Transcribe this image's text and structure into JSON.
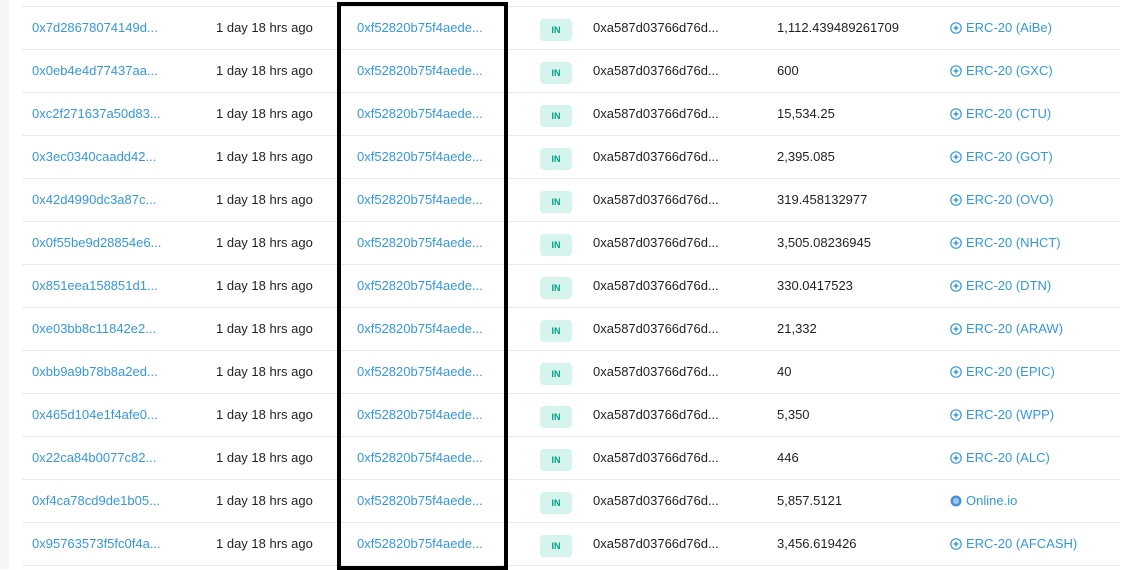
{
  "table": {
    "direction_badge": "IN",
    "rows": [
      {
        "hash": "0x7d28678074149d...",
        "age": "1 day 18 hrs ago",
        "from": "0xf52820b75f4aede...",
        "to": "0xa587d03766d76d...",
        "value": "1,112.439489261709",
        "token": "ERC-20 (AiBe)",
        "token_icon": "erc20-token-icon"
      },
      {
        "hash": "0x0eb4e4d77437aa...",
        "age": "1 day 18 hrs ago",
        "from": "0xf52820b75f4aede...",
        "to": "0xa587d03766d76d...",
        "value": "600",
        "token": "ERC-20 (GXC)",
        "token_icon": "erc20-token-icon"
      },
      {
        "hash": "0xc2f271637a50d83...",
        "age": "1 day 18 hrs ago",
        "from": "0xf52820b75f4aede...",
        "to": "0xa587d03766d76d...",
        "value": "15,534.25",
        "token": "ERC-20 (CTU)",
        "token_icon": "erc20-token-icon"
      },
      {
        "hash": "0x3ec0340caadd42...",
        "age": "1 day 18 hrs ago",
        "from": "0xf52820b75f4aede...",
        "to": "0xa587d03766d76d...",
        "value": "2,395.085",
        "token": "ERC-20 (GOT)",
        "token_icon": "erc20-token-icon"
      },
      {
        "hash": "0x42d4990dc3a87c...",
        "age": "1 day 18 hrs ago",
        "from": "0xf52820b75f4aede...",
        "to": "0xa587d03766d76d...",
        "value": "319.458132977",
        "token": "ERC-20 (OVO)",
        "token_icon": "erc20-token-icon"
      },
      {
        "hash": "0x0f55be9d28854e6...",
        "age": "1 day 18 hrs ago",
        "from": "0xf52820b75f4aede...",
        "to": "0xa587d03766d76d...",
        "value": "3,505.08236945",
        "token": "ERC-20 (NHCT)",
        "token_icon": "erc20-token-icon"
      },
      {
        "hash": "0x851eea158851d1...",
        "age": "1 day 18 hrs ago",
        "from": "0xf52820b75f4aede...",
        "to": "0xa587d03766d76d...",
        "value": "330.0417523",
        "token": "ERC-20 (DTN)",
        "token_icon": "erc20-token-icon"
      },
      {
        "hash": "0xe03bb8c11842e2...",
        "age": "1 day 18 hrs ago",
        "from": "0xf52820b75f4aede...",
        "to": "0xa587d03766d76d...",
        "value": "21,332",
        "token": "ERC-20 (ARAW)",
        "token_icon": "erc20-token-icon"
      },
      {
        "hash": "0xbb9a9b78b8a2ed...",
        "age": "1 day 18 hrs ago",
        "from": "0xf52820b75f4aede...",
        "to": "0xa587d03766d76d...",
        "value": "40",
        "token": "ERC-20 (EPIC)",
        "token_icon": "erc20-token-icon"
      },
      {
        "hash": "0x465d104e1f4afe0...",
        "age": "1 day 18 hrs ago",
        "from": "0xf52820b75f4aede...",
        "to": "0xa587d03766d76d...",
        "value": "5,350",
        "token": "ERC-20 (WPP)",
        "token_icon": "erc20-token-icon"
      },
      {
        "hash": "0x22ca84b0077c82...",
        "age": "1 day 18 hrs ago",
        "from": "0xf52820b75f4aede...",
        "to": "0xa587d03766d76d...",
        "value": "446",
        "token": "ERC-20 (ALC)",
        "token_icon": "erc20-token-icon"
      },
      {
        "hash": "0xf4ca78cd9de1b05...",
        "age": "1 day 18 hrs ago",
        "from": "0xf52820b75f4aede...",
        "to": "0xa587d03766d76d...",
        "value": "5,857.5121",
        "token": "Online.io",
        "token_icon": "online-io-token-icon"
      },
      {
        "hash": "0x95763573f5fc0f4a...",
        "age": "1 day 18 hrs ago",
        "from": "0xf52820b75f4aede...",
        "to": "0xa587d03766d76d...",
        "value": "3,456.619426",
        "token": "ERC-20 (AFCASH)",
        "token_icon": "erc20-token-icon"
      }
    ]
  },
  "colors": {
    "link": "#3498db",
    "badge_bg": "#d6f4ee",
    "badge_text": "#00a186",
    "row_border": "#e7eaf3",
    "highlight": "#000000"
  }
}
